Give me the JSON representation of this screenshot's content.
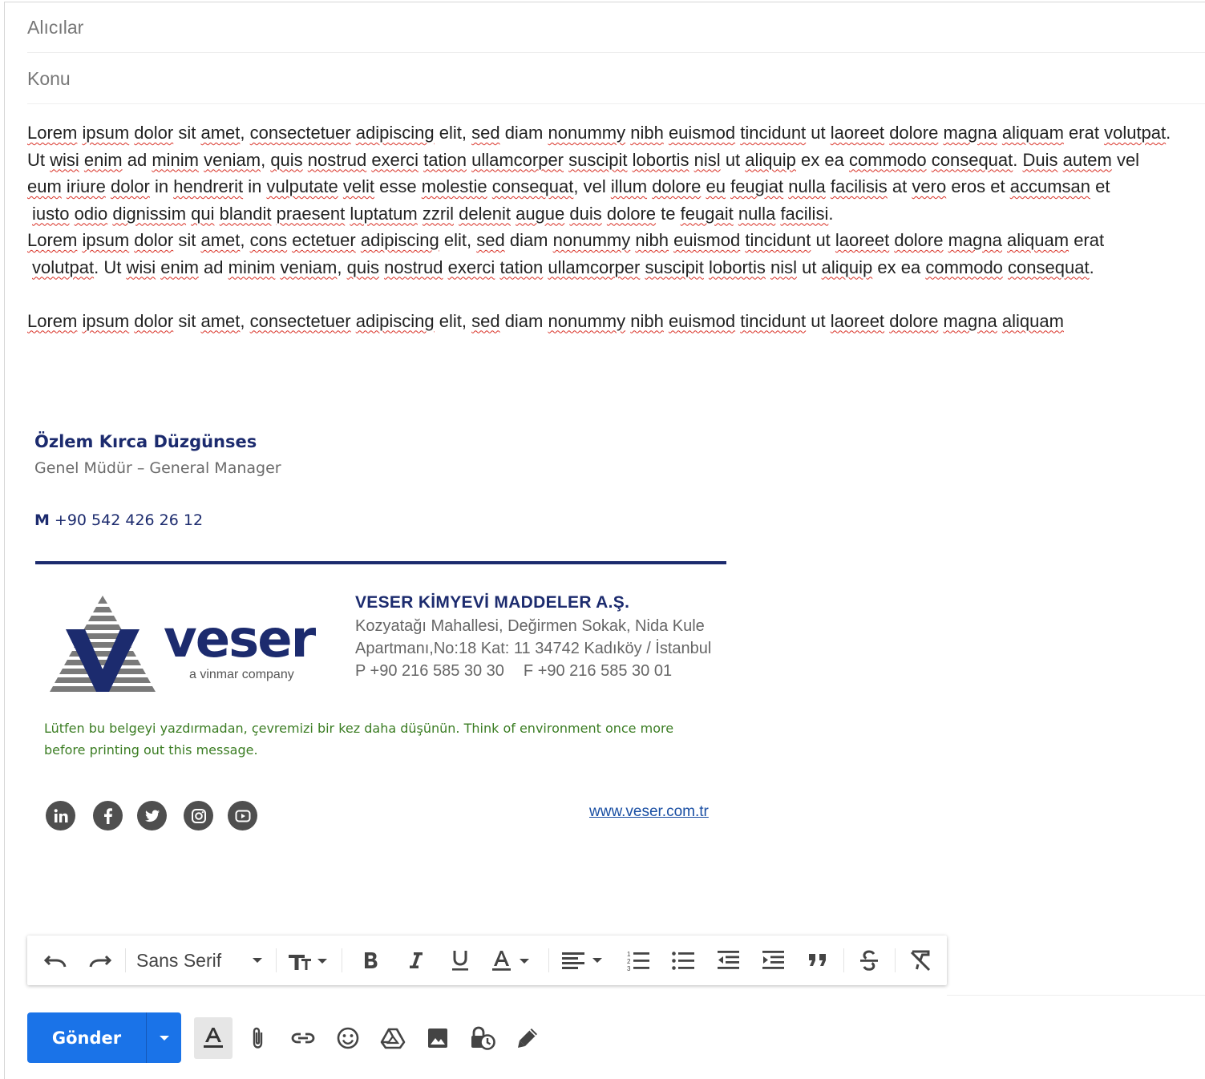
{
  "compose": {
    "recipients_placeholder": "Alıcılar",
    "subject_placeholder": "Konu"
  },
  "body": {
    "lines": [
      "Lorem ipsum dolor sit amet, consectetuer adipiscing elit, sed diam nonummy nibh euismod tincidunt ut laoreet dolore magna aliquam erat volutpat.",
      "Ut wisi enim ad minim veniam, quis nostrud exerci tation ullamcorper suscipit lobortis nisl ut aliquip ex ea commodo consequat. Duis autem vel",
      "eum iriure dolor in hendrerit in vulputate velit esse molestie consequat, vel illum dolore eu feugiat nulla facilisis at vero eros et accumsan et",
      "iusto odio dignissim qui blandit praesent luptatum zzril delenit augue duis dolore te feugait nulla facilisi.",
      "Lorem ipsum dolor sit amet, cons ectetuer adipiscing elit, sed diam nonummy nibh euismod tincidunt ut laoreet dolore magna aliquam erat",
      "volutpat. Ut wisi enim ad minim veniam, quis nostrud exerci tation ullamcorper suscipit lobortis nisl ut aliquip ex ea commodo consequat.",
      "Lorem ipsum dolor sit amet, consectetuer adipiscing elit, sed diam nonummy nibh euismod tincidunt ut laoreet dolore magna aliquam"
    ]
  },
  "signature": {
    "name": "Özlem Kırca Düzgünses",
    "title": "Genel Müdür – General Manager",
    "mobile_label": "M",
    "mobile": "+90 542 426 26 12",
    "accent_color": "#1c2b6e"
  },
  "company": {
    "logo_word": "veser",
    "logo_tagline": "a vinmar company",
    "name": "VESER KİMYEVİ MADDELER A.Ş.",
    "address_line1": "Kozyatağı Mahallesi, Değirmen Sokak, Nida Kule",
    "address_line2": "Apartmanı,No:18 Kat: 11 34742 Kadıköy / İstanbul",
    "phone": "P +90 216 585 30 30",
    "fax": "F +90 216 585 30 01",
    "eco_note": "Lütfen bu belgeyi yazdırmadan, çevremizi bir kez daha düşünün. Think of environment once more before printing out this message.",
    "website": "www.veser.com.tr",
    "social_icons": [
      "linkedin-icon",
      "facebook-icon",
      "twitter-icon",
      "instagram-icon",
      "youtube-icon"
    ]
  },
  "toolbar": {
    "font_name": "Sans Serif",
    "items": [
      "undo-icon",
      "redo-icon",
      "font-size-icon",
      "bold-icon",
      "italic-icon",
      "underline-icon",
      "text-color-icon",
      "align-icon",
      "numbered-list-icon",
      "bulleted-list-icon",
      "indent-less-icon",
      "indent-more-icon",
      "quote-icon",
      "strikethrough-icon",
      "remove-formatting-icon"
    ]
  },
  "bottom_bar": {
    "send_label": "Gönder",
    "send_color": "#1a73e8",
    "items": [
      "formatting-options-icon",
      "attach-icon",
      "link-icon",
      "emoji-icon",
      "drive-icon",
      "photo-icon",
      "confidential-icon",
      "signature-icon"
    ]
  }
}
